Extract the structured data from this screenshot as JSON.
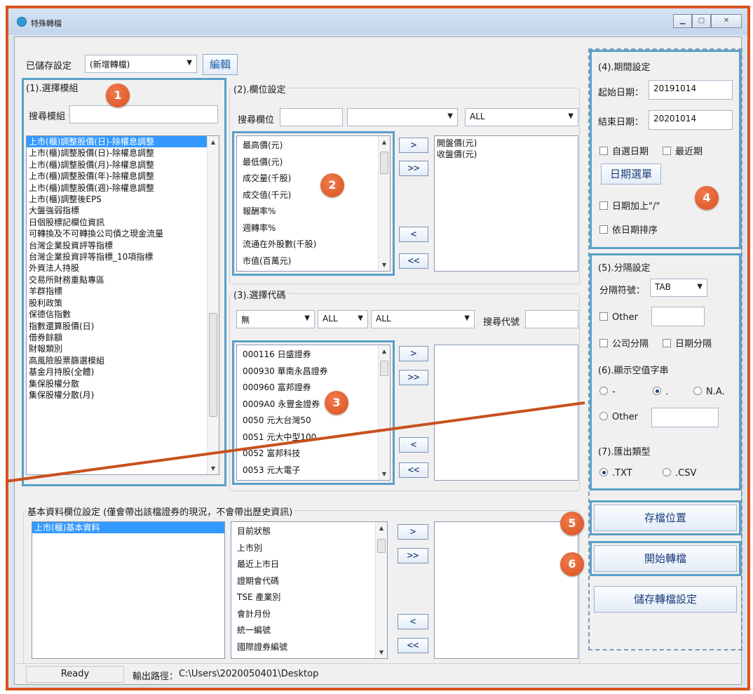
{
  "window": {
    "title": "特殊轉檔"
  },
  "saved_settings": {
    "label": "已儲存設定",
    "value": "(新增轉檔)",
    "edit_button": "編輯"
  },
  "module": {
    "group_title": "(1).選擇模組",
    "search_label": "搜尋模組",
    "items": [
      "上市(櫃)調整股價(日)-除權息調整",
      "上市(櫃)調整股價(日)-除權息調整",
      "上市(櫃)調整股價(月)-除權息調整",
      "上市(櫃)調整股價(年)-除權息調整",
      "上市(櫃)調整股價(週)-除權息調整",
      "上市(櫃)調整後EPS",
      "大盤強弱指標",
      "日個股標記欄位資訊",
      "可轉換及不可轉換公司債之現金流量",
      "台灣企業投資評等指標",
      "台灣企業投資評等指標_10項指標",
      "外資法人持股",
      "交易所財務重點專區",
      "羊群指標",
      "股利政策",
      "保德信指數",
      "指數還算股價(日)",
      "借券餘額",
      "財報類別",
      "高風險股票篩選模組",
      "基金月持股(全體)",
      "集保股權分散",
      "集保股權分散(月)"
    ]
  },
  "fields": {
    "group_title": "(2).欄位設定",
    "search_label": "搜尋欄位",
    "combo_all": "ALL",
    "available": [
      "最高價(元)",
      "最低價(元)",
      "成交量(千股)",
      "成交值(千元)",
      "報酬率%",
      "週轉率%",
      "流通在外股數(千股)",
      "市值(百萬元)"
    ],
    "selected": [
      "開盤價(元)",
      "收盤價(元)"
    ]
  },
  "codes": {
    "group_title": "(3).選擇代碼",
    "combo1": "無",
    "combo2": "ALL",
    "combo3": "ALL",
    "search_label": "搜尋代號",
    "available": [
      "000116 日盛證券",
      "000930 華南永昌證券",
      "000960 富邦證券",
      "0009A0 永豐金證券",
      "0050 元大台灣50",
      "0051 元大中型100",
      "0052 富邦科技",
      "0053 元大電子"
    ]
  },
  "basic": {
    "group_title": "基本資料欄位設定 (僅會帶出該檔證券的現況，不會帶出歷史資訊)",
    "modules": [
      "上市(櫃)基本資料"
    ],
    "available": [
      "目前狀態",
      "上市別",
      "最近上市日",
      "證期會代碼",
      "TSE 產業別",
      "會計月份",
      "統一編號",
      "國際證券編號"
    ]
  },
  "transfer_buttons": {
    "add": ">",
    "add_all": ">>",
    "remove": "<",
    "remove_all": "<<"
  },
  "period": {
    "group_title": "(4).期間設定",
    "start_label": "起始日期：",
    "start_value": "20191014",
    "end_label": "結束日期：",
    "end_value": "20201014",
    "custom_date": "自選日期",
    "recent": "最近期",
    "date_menu_button": "日期選單",
    "date_slash": "日期加上\"/\"",
    "sort_by_date": "依日期排序"
  },
  "separator": {
    "group_title": "(5).分隔設定",
    "symbol_label": "分隔符號：",
    "symbol_value": "TAB",
    "other": "Other",
    "company_sep": "公司分隔",
    "date_sep": "日期分隔"
  },
  "empty_value": {
    "group_title": "(6).顯示空值字串",
    "opt_dash": "-",
    "opt_dot": ".",
    "opt_na": "N.A.",
    "other": "Other",
    "selected": "."
  },
  "export_type": {
    "group_title": "(7).匯出類型",
    "opt_txt": ".TXT",
    "opt_csv": ".CSV",
    "selected": ".TXT"
  },
  "actions": {
    "save_location": "存檔位置",
    "start_convert": "開始轉檔",
    "save_settings": "儲存轉檔設定"
  },
  "badges": [
    "1",
    "2",
    "3",
    "4",
    "5",
    "6"
  ],
  "status": {
    "ready": "Ready",
    "output_label": "輸出路徑：",
    "output_path": "C:\\Users\\2020050401\\Desktop"
  }
}
